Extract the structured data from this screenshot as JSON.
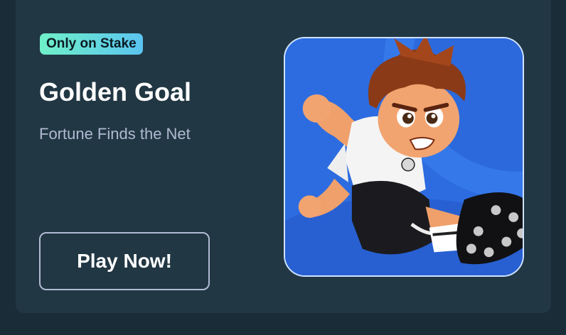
{
  "promo": {
    "badge": "Only on Stake",
    "title": "Golden Goal",
    "subtitle": "Fortune Finds the Net",
    "cta_label": "Play Now!"
  },
  "colors": {
    "card_bg": "#213743",
    "page_bg": "#1a2c38",
    "badge_gradient_start": "#6ff0c8",
    "badge_gradient_end": "#5ac4f0",
    "subtitle": "#b1bad3",
    "art_bg": "#2f6fe0"
  },
  "icons": {
    "game_art": "soccer-player-kicking-art"
  }
}
